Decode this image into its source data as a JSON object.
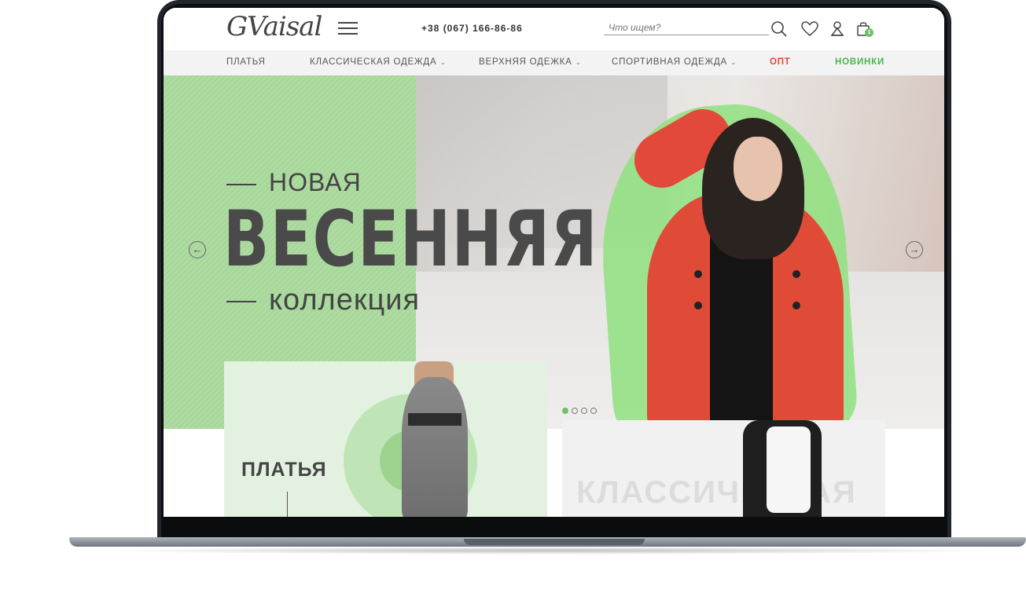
{
  "header": {
    "logo": "GVaisal",
    "phone": "+38 (067) 166-86-86",
    "search_placeholder": "Что ищем?",
    "cart_count": "1"
  },
  "nav": {
    "items": [
      {
        "label": "ПЛАТЬЯ"
      },
      {
        "label": "КЛАССИЧЕСКАЯ ОДЕЖДА"
      },
      {
        "label": "ВЕРХНЯЯ ОДЕЖКА"
      },
      {
        "label": "СПОРТИВНАЯ ОДЕЖДА"
      },
      {
        "label": "ОПТ"
      },
      {
        "label": "НОВИНКИ"
      }
    ],
    "chevron": "⌄"
  },
  "hero": {
    "line1": "НОВАЯ",
    "line2": "ВЕСЕННЯЯ",
    "line3": "коллекция",
    "prev_arrow": "←",
    "next_arrow": "→",
    "slides_total": 4,
    "active_slide": 1
  },
  "categories": [
    {
      "title": "ПЛАТЬЯ"
    },
    {
      "title": "КЛАССИЧЕСКАЯ"
    }
  ],
  "colors": {
    "accent_green": "#6fc167",
    "opt_red": "#e8433b",
    "new_green": "#48b54a",
    "hero_green": "#9ad18c"
  },
  "icons": [
    "search-icon",
    "heart-icon",
    "user-icon",
    "cart-icon",
    "menu-icon"
  ]
}
